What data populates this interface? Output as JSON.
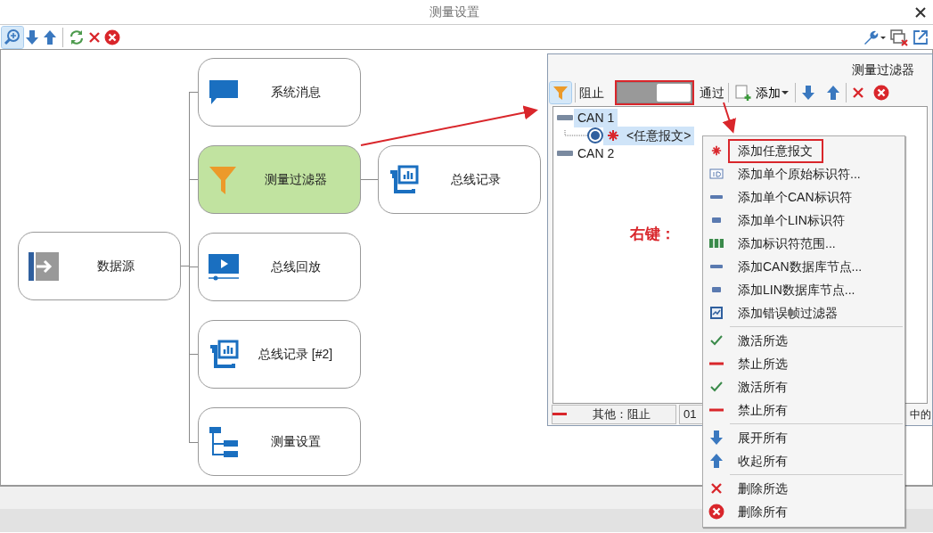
{
  "window": {
    "title": "测量设置"
  },
  "diagram": {
    "nodes": [
      {
        "label": "系统消息",
        "selected": false
      },
      {
        "label": "测量过滤器",
        "selected": true
      },
      {
        "label": "总线记录",
        "selected": false
      },
      {
        "label": "数据源",
        "selected": false
      },
      {
        "label": "总线回放",
        "selected": false
      },
      {
        "label": "总线记录 [#2]",
        "selected": false
      },
      {
        "label": "测量设置",
        "selected": false
      }
    ]
  },
  "filter_panel": {
    "title": "测量过滤器",
    "toolbar": {
      "filter_active": true,
      "block_label": "阻止",
      "pass": true,
      "pass_boxed": true,
      "pass_label": "通过",
      "add_label": "添加"
    },
    "tree": [
      {
        "label": "CAN 1",
        "selected": true,
        "children": [
          {
            "label": "<任意报文>",
            "selected": true
          }
        ]
      },
      {
        "label": "CAN 2",
        "selected": false
      }
    ],
    "status_bar": {
      "other": "其他：阻止",
      "code": "01",
      "text": "中的"
    }
  },
  "annotation": {
    "label": "右键："
  },
  "context_menu": {
    "groups": [
      [
        {
          "label": "添加任意报文",
          "boxed": true
        },
        {
          "label": "添加单个原始标识符...",
          "boxed": false
        },
        {
          "label": "添加单个CAN标识符",
          "boxed": false
        },
        {
          "label": "添加单个LIN标识符",
          "boxed": false
        },
        {
          "label": "添加标识符范围...",
          "boxed": false
        },
        {
          "label": "添加CAN数据库节点...",
          "boxed": false
        },
        {
          "label": "添加LIN数据库节点...",
          "boxed": false
        },
        {
          "label": "添加错误帧过滤器",
          "boxed": false
        }
      ],
      [
        {
          "label": "激活所选",
          "boxed": false
        },
        {
          "label": "禁止所选",
          "boxed": false
        },
        {
          "label": "激活所有",
          "boxed": false
        },
        {
          "label": "禁止所有",
          "boxed": false
        }
      ],
      [
        {
          "label": "展开所有",
          "boxed": false
        },
        {
          "label": "收起所有",
          "boxed": false
        }
      ],
      [
        {
          "label": "删除所选",
          "boxed": false
        },
        {
          "label": "删除所有",
          "boxed": false
        }
      ]
    ]
  }
}
